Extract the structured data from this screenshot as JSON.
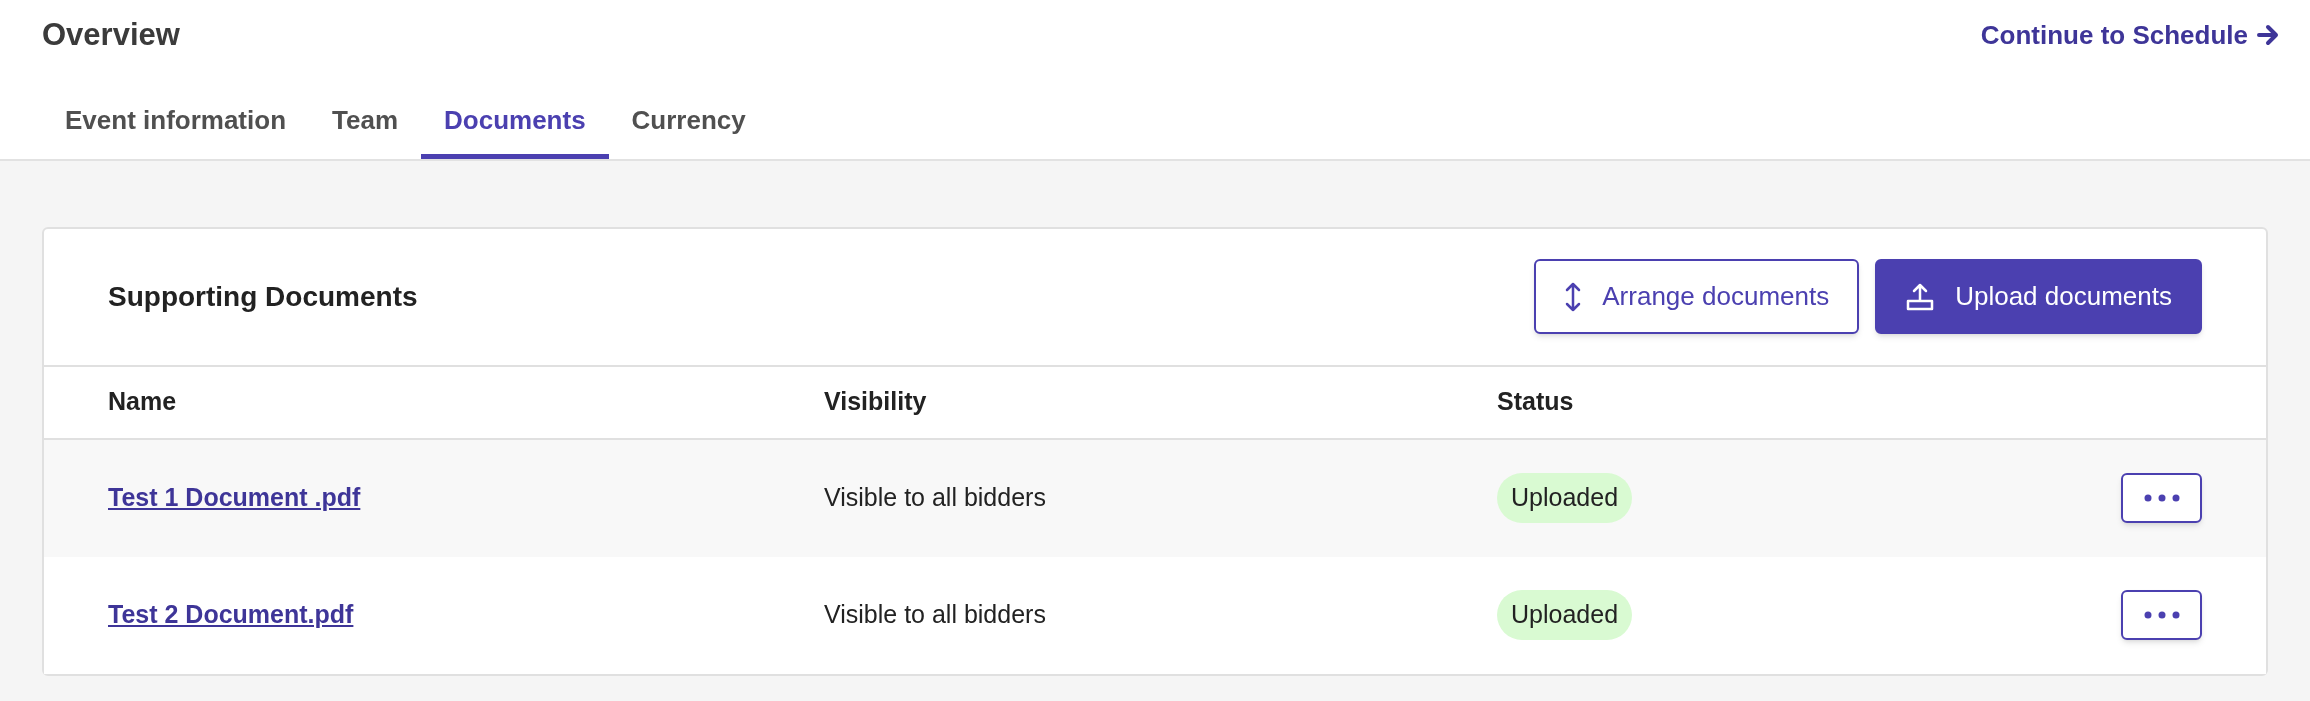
{
  "page": {
    "title": "Overview",
    "continue_link": "Continue to Schedule"
  },
  "tabs": [
    {
      "label": "Event information",
      "selected": false
    },
    {
      "label": "Team",
      "selected": false
    },
    {
      "label": "Documents",
      "selected": true
    },
    {
      "label": "Currency",
      "selected": false
    }
  ],
  "card": {
    "title": "Supporting Documents",
    "buttons": [
      {
        "label": "Arrange documents",
        "kind": "outline"
      },
      {
        "label": "Upload documents",
        "kind": "primary"
      }
    ]
  },
  "table": {
    "columns": [
      "Name",
      "Visibility",
      "Status"
    ],
    "rows": [
      {
        "name": "Test 1 Document .pdf",
        "visibility": "Visible to all bidders",
        "status": "Uploaded",
        "color": "#d9fad2"
      },
      {
        "name": "Test 2 Document.pdf",
        "visibility": "Visible to all bidders",
        "status": "Uploaded",
        "color": "#d9fad2"
      }
    ]
  }
}
